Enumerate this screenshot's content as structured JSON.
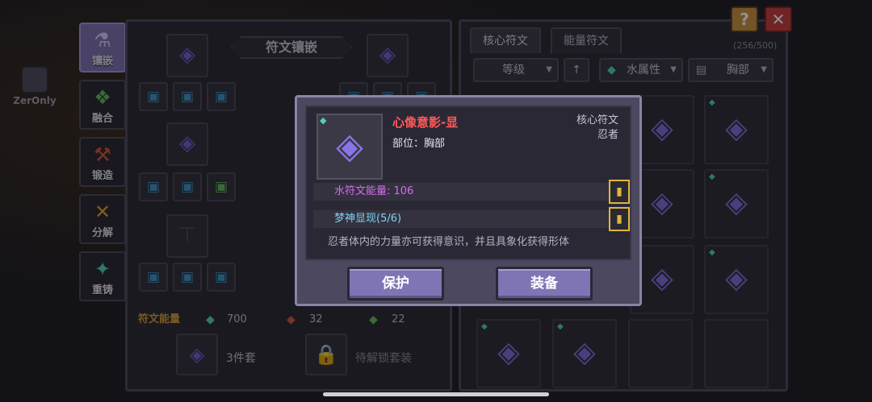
{
  "bg_player_name": "ZerOnly",
  "top_buttons": {
    "help": "?",
    "close": "✕"
  },
  "sidenav": [
    {
      "label": "镶嵌",
      "icon": "flask-icon",
      "glyph": "⚗",
      "active": true
    },
    {
      "label": "融合",
      "icon": "swirl-icon",
      "glyph": "❖",
      "active": false
    },
    {
      "label": "锻造",
      "icon": "anvil-icon",
      "glyph": "⚒",
      "active": false
    },
    {
      "label": "分解",
      "icon": "split-icon",
      "glyph": "✕",
      "active": false
    },
    {
      "label": "重铸",
      "icon": "crystal-icon",
      "glyph": "✦",
      "active": false
    }
  ],
  "left_panel": {
    "title": "符文镶嵌",
    "small_slot_level": "6",
    "energy_label": "符文能量",
    "energy_water": "700",
    "energy_fire": "32",
    "energy_wood": "22",
    "set_label": "3件套",
    "locked_set_label": "待解锁套装"
  },
  "right_panel": {
    "tabs": [
      "核心符文",
      "能量符文"
    ],
    "count": "(256/500)",
    "filter_level": "等级",
    "filter_sort_icon": "↑",
    "filter_element": "水属性",
    "filter_part": "胸部"
  },
  "modal": {
    "rune_name": "心像意影-显",
    "rune_slot": "部位：胸部",
    "rune_type": "核心符文",
    "rune_class": "忍者",
    "attr1": "水符文能量: 106",
    "attr2": "梦神显现(5/6)",
    "description": "忍者体内的力量亦可获得意识，并且具象化获得形体",
    "protect_button": "保护",
    "equip_button": "装备"
  },
  "colors": {
    "rune_name": "#ff5a5a",
    "attr_energy": "#d56cf0",
    "attr_set": "#7bd2f7",
    "energy_label": "#d49a3c",
    "button": "#7f75b4"
  }
}
